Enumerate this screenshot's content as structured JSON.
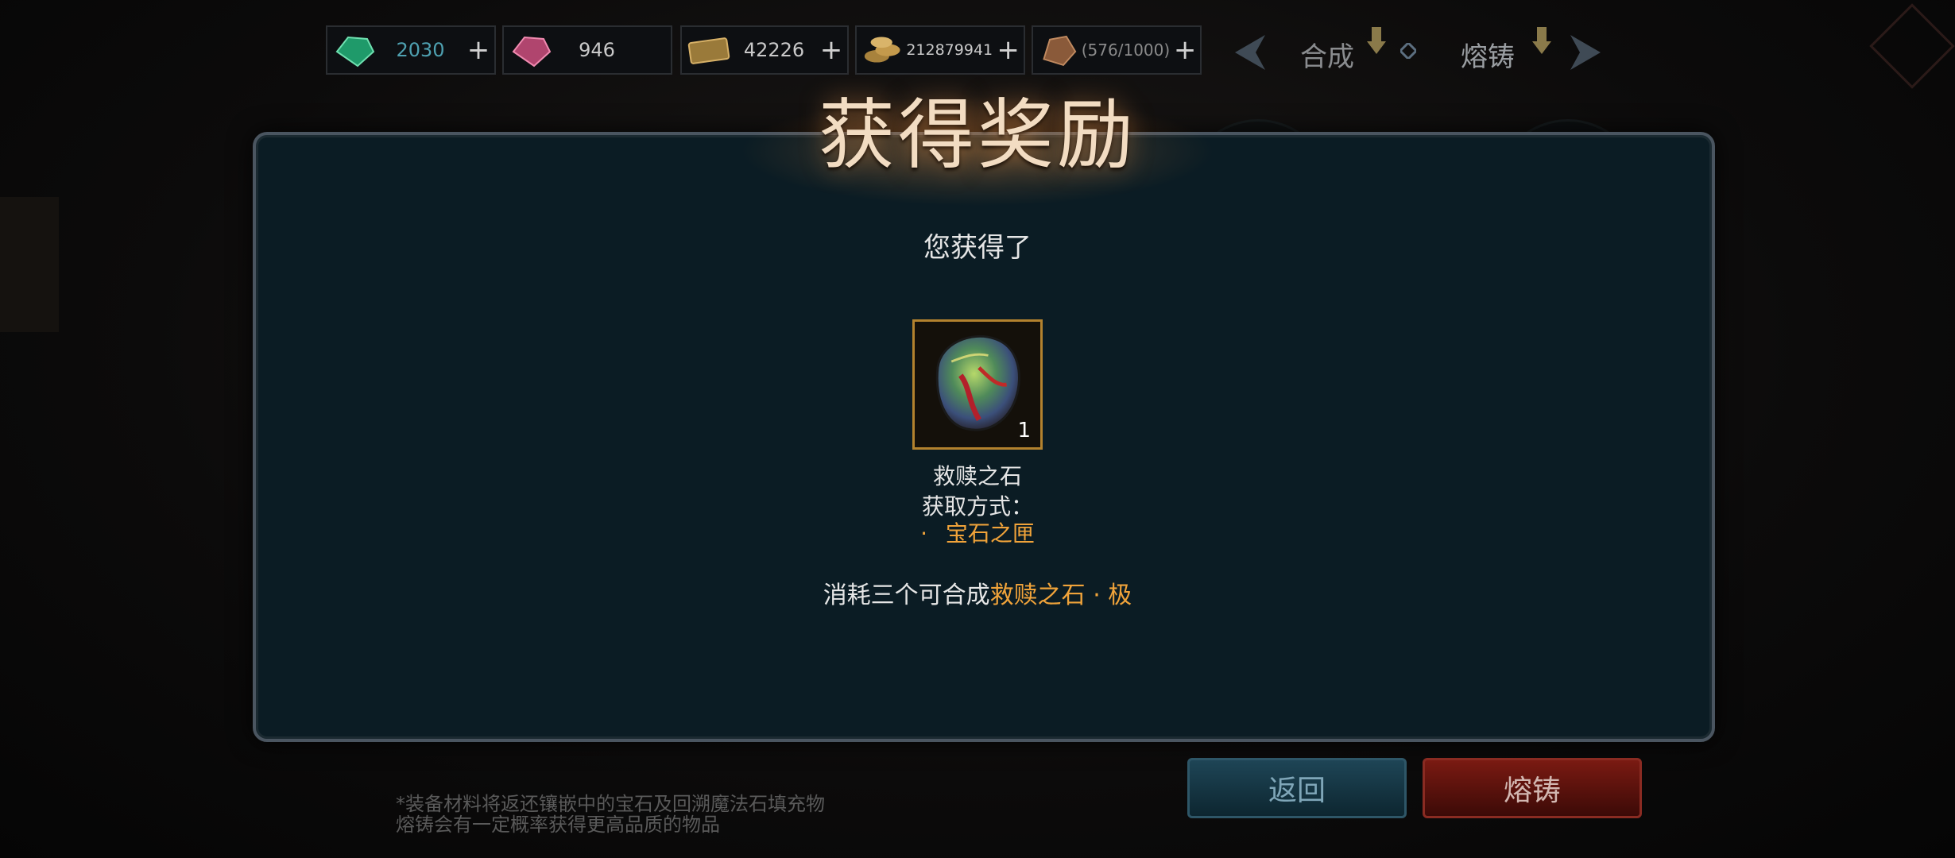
{
  "resources": [
    {
      "name": "green-gem",
      "value": "2030",
      "plus": "+"
    },
    {
      "name": "red-gem",
      "value": "946",
      "plus": "+"
    },
    {
      "name": "ticket",
      "value": "42226",
      "plus": "+"
    },
    {
      "name": "gold",
      "value": "212879941",
      "plus": "+"
    },
    {
      "name": "stamina",
      "value": "(576/1000)",
      "plus": "+"
    }
  ],
  "tabs": {
    "synthesize": "合成",
    "forge": "熔铸"
  },
  "dialog": {
    "title": "获得奖励",
    "subtitle": "您获得了",
    "item": {
      "name": "救赎之石",
      "count": "1"
    },
    "obtain_label": "获取方式：",
    "obtain_bullet": "·",
    "obtain_source": "宝石之匣",
    "combine_prefix": "消耗三个可合成",
    "combine_target": "救赎之石 · 极"
  },
  "buttons": {
    "back": "返回",
    "forge": "熔铸"
  },
  "notes": [
    "*装备材料将返还镶嵌中的宝石及回溯魔法石填充物",
    "熔铸会有一定概率获得更高品质的物品"
  ],
  "colors": {
    "accent_orange": "#f0a33a",
    "text_white": "#e6e6e6",
    "item_border": "#b3822e"
  }
}
